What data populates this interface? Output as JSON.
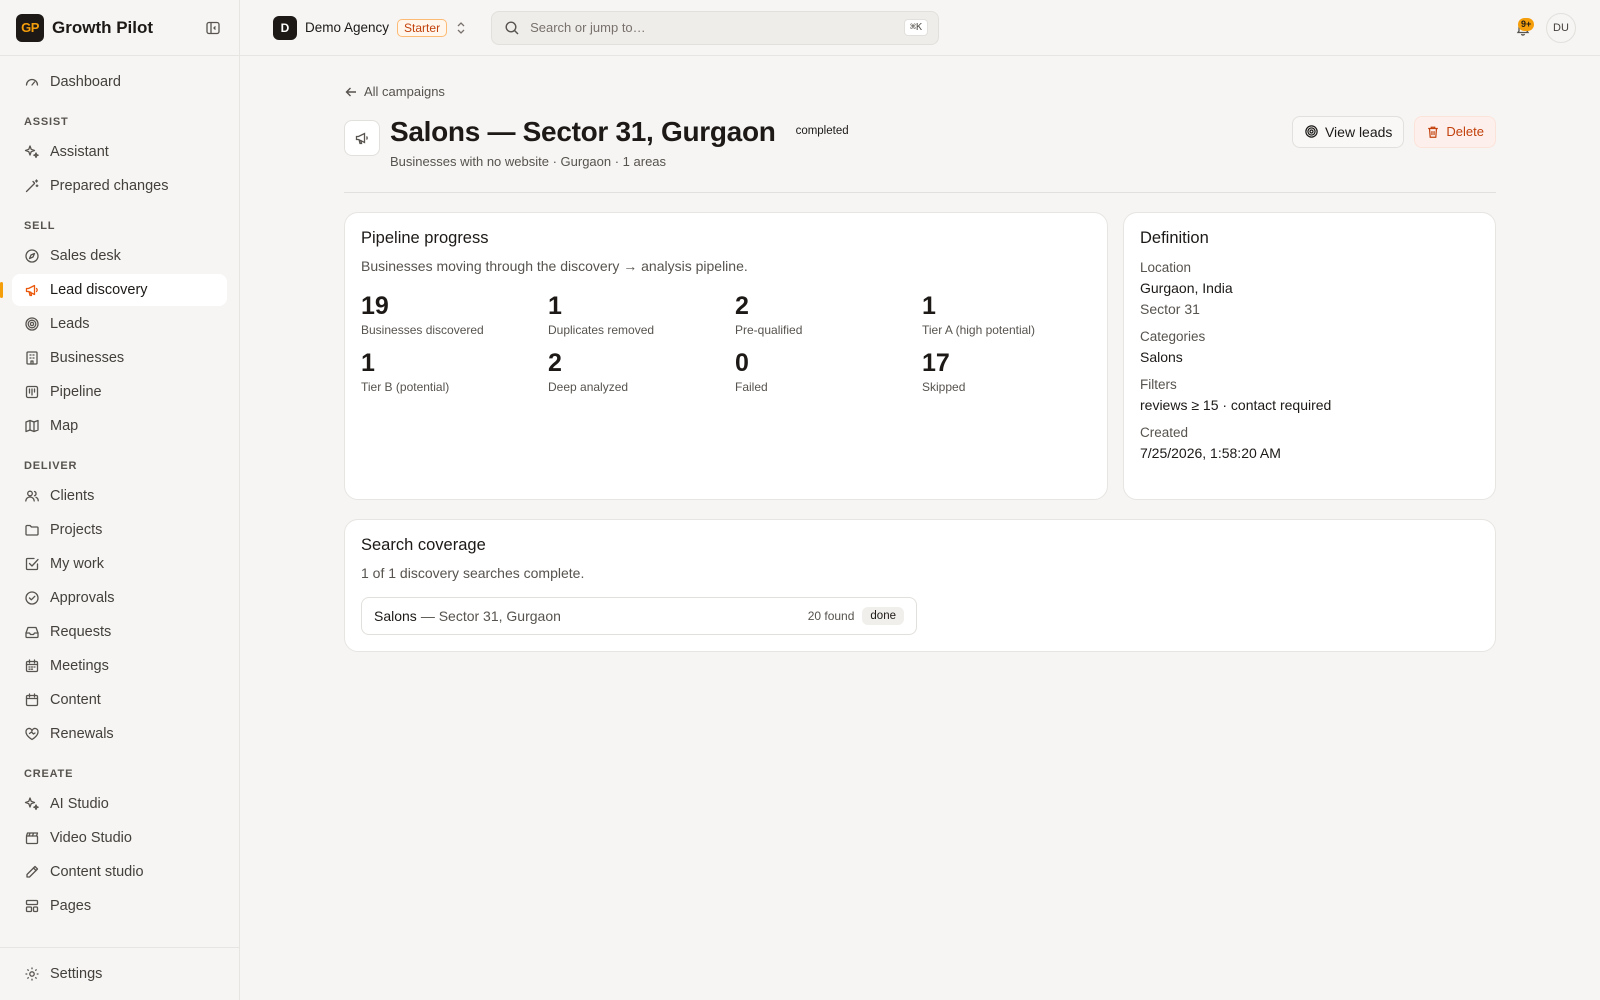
{
  "brand": {
    "logo_text": "GP",
    "name": "Growth Pilot"
  },
  "sidebar": {
    "top_items": [
      {
        "label": "Dashboard",
        "icon": "gauge-icon"
      }
    ],
    "sections": [
      {
        "title": "ASSIST",
        "items": [
          {
            "label": "Assistant",
            "icon": "sparkles-icon"
          },
          {
            "label": "Prepared changes",
            "icon": "wand-icon"
          }
        ]
      },
      {
        "title": "SELL",
        "items": [
          {
            "label": "Sales desk",
            "icon": "compass-icon"
          },
          {
            "label": "Lead discovery",
            "icon": "megaphone-icon",
            "active": true
          },
          {
            "label": "Leads",
            "icon": "target-icon"
          },
          {
            "label": "Businesses",
            "icon": "building-icon"
          },
          {
            "label": "Pipeline",
            "icon": "kanban-icon"
          },
          {
            "label": "Map",
            "icon": "map-icon"
          }
        ]
      },
      {
        "title": "DELIVER",
        "items": [
          {
            "label": "Clients",
            "icon": "users-icon"
          },
          {
            "label": "Projects",
            "icon": "folder-icon"
          },
          {
            "label": "My work",
            "icon": "check-square-icon"
          },
          {
            "label": "Approvals",
            "icon": "check-circle-icon"
          },
          {
            "label": "Requests",
            "icon": "inbox-icon"
          },
          {
            "label": "Meetings",
            "icon": "calendar-icon"
          },
          {
            "label": "Content",
            "icon": "calendar-days-icon"
          },
          {
            "label": "Renewals",
            "icon": "heart-handshake-icon"
          }
        ]
      },
      {
        "title": "CREATE",
        "items": [
          {
            "label": "AI Studio",
            "icon": "sparkles-icon"
          },
          {
            "label": "Video Studio",
            "icon": "clapperboard-icon"
          },
          {
            "label": "Content studio",
            "icon": "pen-icon"
          },
          {
            "label": "Pages",
            "icon": "layout-icon"
          }
        ]
      }
    ],
    "settings_label": "Settings"
  },
  "topbar": {
    "workspace_initial": "D",
    "workspace_name": "Demo Agency",
    "plan": "Starter",
    "search_placeholder": "Search or jump to…",
    "search_shortcut": "⌘K",
    "notification_count": "9+",
    "user_initials": "DU"
  },
  "page": {
    "back_label": "All campaigns",
    "title": "Salons — Sector 31, Gurgaon",
    "status": "completed",
    "subtitle": "Businesses with no website · Gurgaon · 1 areas",
    "view_leads_label": "View leads",
    "delete_label": "Delete"
  },
  "pipeline": {
    "title": "Pipeline progress",
    "description": "Businesses moving through the discovery → analysis pipeline.",
    "stats": [
      {
        "value": "19",
        "label": "Businesses discovered"
      },
      {
        "value": "1",
        "label": "Duplicates removed"
      },
      {
        "value": "2",
        "label": "Pre-qualified"
      },
      {
        "value": "1",
        "label": "Tier A (high potential)"
      },
      {
        "value": "1",
        "label": "Tier B (potential)"
      },
      {
        "value": "2",
        "label": "Deep analyzed"
      },
      {
        "value": "0",
        "label": "Failed"
      },
      {
        "value": "17",
        "label": "Skipped"
      }
    ]
  },
  "definition": {
    "title": "Definition",
    "location_label": "Location",
    "location_value": "Gurgaon, India",
    "location_area": "Sector 31",
    "categories_label": "Categories",
    "categories_value": "Salons",
    "filters_label": "Filters",
    "filters_value": "reviews ≥ 15 · contact required",
    "created_label": "Created",
    "created_value": "7/25/2026, 1:58:20 AM"
  },
  "coverage": {
    "title": "Search coverage",
    "description": "1 of 1 discovery searches complete.",
    "rows": [
      {
        "category": "Salons",
        "area": "— Sector 31, Gurgaon",
        "found": "20 found",
        "status": "done"
      }
    ]
  },
  "colors": {
    "accent": "#f59e0b",
    "danger": "#c2410c",
    "brand_dark": "#1c1917"
  }
}
